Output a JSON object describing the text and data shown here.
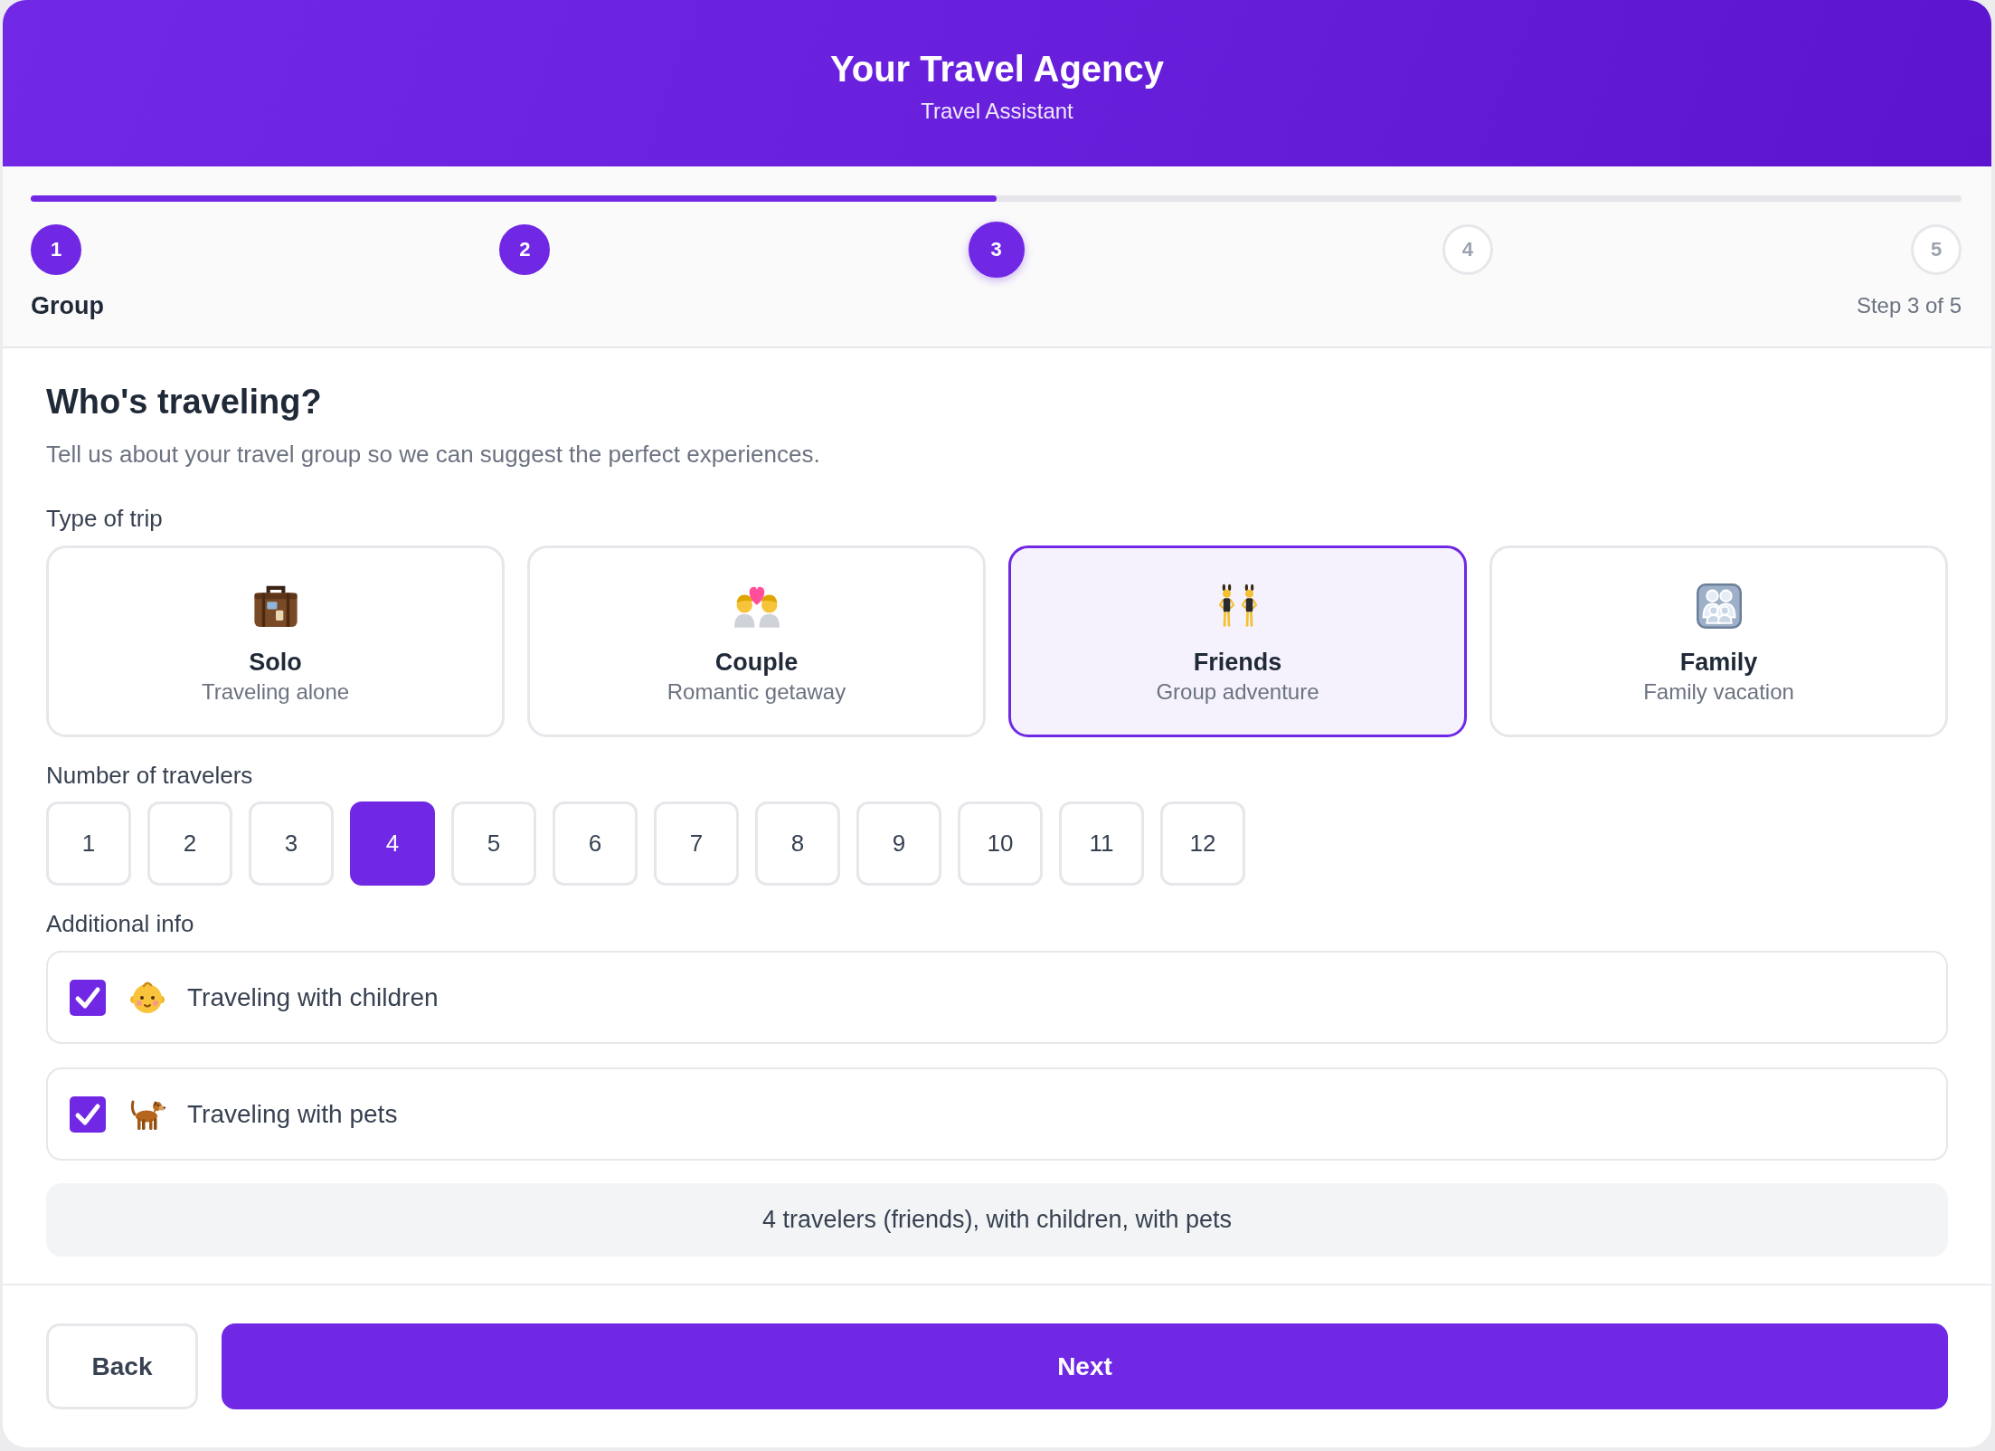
{
  "header": {
    "title": "Your Travel Agency",
    "subtitle": "Travel Assistant"
  },
  "progress": {
    "level": 0.5,
    "steps": [
      {
        "number": "1",
        "completed": true,
        "selected": false
      },
      {
        "number": "2",
        "completed": true,
        "selected": false
      },
      {
        "number": "3",
        "completed": false,
        "selected": true
      },
      {
        "number": "4",
        "completed": false,
        "selected": false
      },
      {
        "number": "5",
        "completed": false,
        "selected": false
      }
    ],
    "current_step_name": "Group",
    "step_counter": "Step 3 of 5"
  },
  "heading": "Who's traveling?",
  "description": "Tell us about your travel group so we can suggest the perfect experiences.",
  "trip_type": {
    "label": "Type of trip",
    "options": [
      {
        "title": "Solo",
        "description": "Traveling alone",
        "selected": false
      },
      {
        "title": "Couple",
        "description": "Romantic getaway",
        "selected": false
      },
      {
        "title": "Friends",
        "description": "Group adventure",
        "selected": true
      },
      {
        "title": "Family",
        "description": "Family vacation",
        "selected": false
      }
    ]
  },
  "travelers": {
    "label": "Number of travelers",
    "options": [
      {
        "label": "1",
        "selected": false
      },
      {
        "label": "2",
        "selected": false
      },
      {
        "label": "3",
        "selected": false
      },
      {
        "label": "4",
        "selected": true
      },
      {
        "label": "5",
        "selected": false
      },
      {
        "label": "6",
        "selected": false
      },
      {
        "label": "7",
        "selected": false
      },
      {
        "label": "8",
        "selected": false
      },
      {
        "label": "9",
        "selected": false
      },
      {
        "label": "10",
        "selected": false
      },
      {
        "label": "11",
        "selected": false
      },
      {
        "label": "12",
        "selected": false
      }
    ]
  },
  "additional_info": {
    "label": "Additional info",
    "options": [
      {
        "label": "Traveling with children",
        "checked": true
      },
      {
        "label": "Traveling with pets",
        "checked": true
      }
    ]
  },
  "summary": "4 travelers (friends), with children, with pets",
  "buttons": [
    {
      "label": "Back",
      "kind": "secondary"
    },
    {
      "label": "Next",
      "kind": "primary"
    }
  ]
}
